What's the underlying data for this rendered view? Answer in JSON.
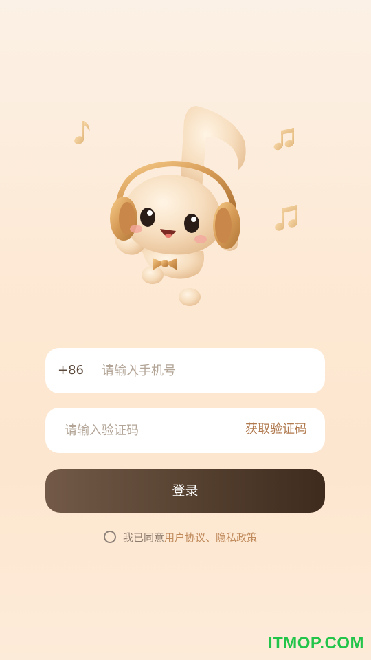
{
  "illustration": {
    "name": "music-note-mascot-with-headphones"
  },
  "phone_field": {
    "prefix": "+86",
    "placeholder": "请输入手机号",
    "value": ""
  },
  "code_field": {
    "placeholder": "请输入验证码",
    "value": "",
    "get_code_label": "获取验证码"
  },
  "login": {
    "label": "登录"
  },
  "agreement": {
    "prefix": "我已同意",
    "user_agreement": "用户协议",
    "separator": "、",
    "privacy_policy": "隐私政策"
  },
  "watermark": {
    "text": "ITMOP.COM"
  },
  "colors": {
    "accent": "#b07a4e",
    "button_dark": "#3e2b1e",
    "button_light": "#735a48",
    "watermark": "#22c54a"
  }
}
